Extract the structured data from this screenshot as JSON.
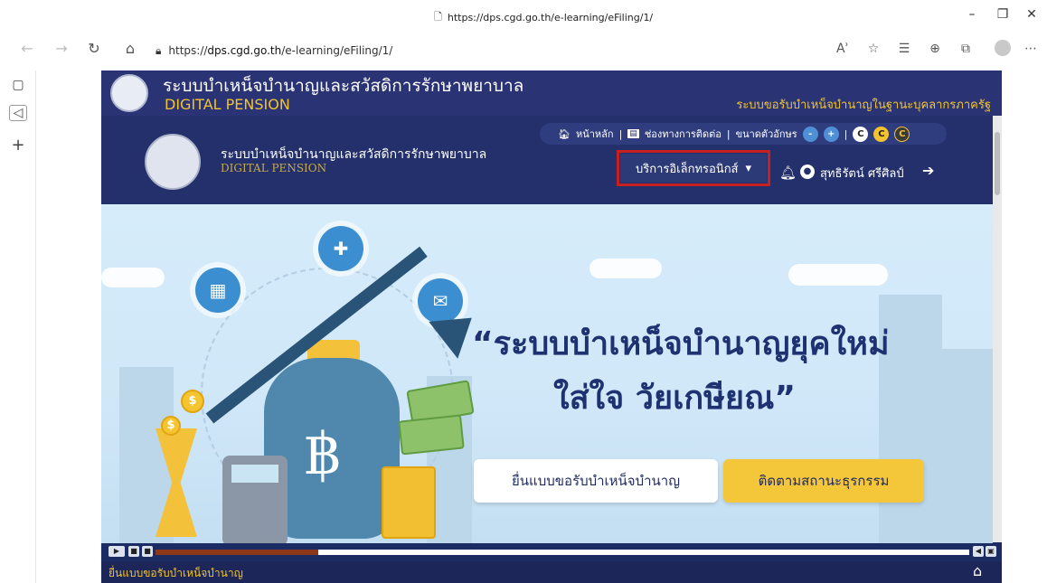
{
  "browser": {
    "title_url": "https://dps.cgd.go.th/e-learning/eFiling/1/",
    "address": {
      "scheme": "https://",
      "host": "dps.cgd.go.th",
      "path": "/e-learning/eFiling/1/"
    },
    "read_aloud_label": "Aʾ"
  },
  "site": {
    "title_th": "ระบบบำเหน็จบำนาญและสวัสดิการรักษาพยาบาล",
    "title_en": "DIGITAL PENSION",
    "slogan": "ระบบขอรับบำเหน็จบำนาญในฐานะบุคลากรภาครัฐ",
    "top_menu": {
      "home": "หน้าหลัก",
      "contact": "ช่องทางการติดต่อ",
      "font_size": "ขนาดตัวอักษร",
      "minus": "-",
      "plus": "+",
      "c": "C"
    },
    "header": {
      "title_th": "ระบบบำเหน็จบำนาญและสวัสดิการรักษาพยาบาล",
      "title_en": "DIGITAL PENSION",
      "eservice": "บริการอิเล็กทรอนิกส์",
      "user_name": "สุทธิรัตน์ ศรีศิลป์"
    },
    "hero": {
      "line1": "“ระบบบำเหน็จบำนาญยุคใหม่",
      "line2": "ใส่ใจ วัยเกษียณ”",
      "apply": "ยื่นแบบขอรับบำเหน็จบำนาญ",
      "track": "ติดตามสถานะธุรกรรม",
      "baht_symbol": "฿"
    },
    "media": {
      "progress": 0.2
    },
    "bottom_label": "ยื่นแบบขอรับบำเหน็จบำนาญ"
  },
  "colors": {
    "navy": "#1f2a5e",
    "gold": "#f2c230",
    "highlight": "#c8201f",
    "hero_bg": "#d6ecfb"
  }
}
